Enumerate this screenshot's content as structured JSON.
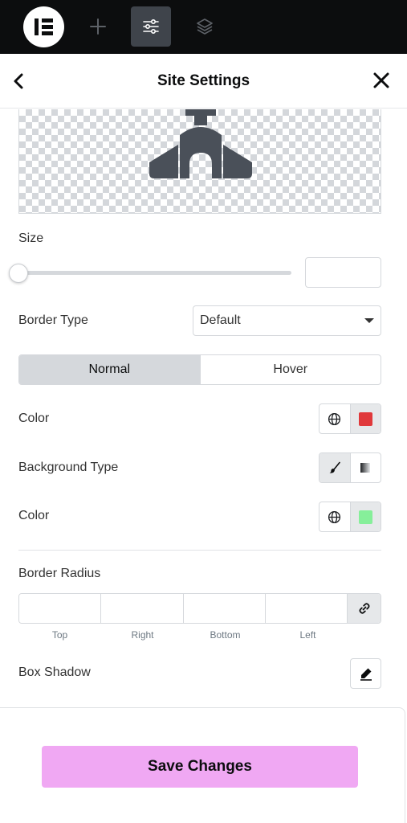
{
  "topbar": {
    "logo_icon": "elementor-logo-icon",
    "buttons": [
      {
        "name": "add-icon"
      },
      {
        "name": "site-settings-icon",
        "active": true
      },
      {
        "name": "layers-icon"
      }
    ]
  },
  "header": {
    "title": "Site Settings",
    "back_icon": "chevron-left-icon",
    "close_icon": "close-icon"
  },
  "preview": {
    "icon": "building-icon",
    "icon_color": "#4a5059"
  },
  "size": {
    "label": "Size",
    "value": "",
    "slider_fraction": 0
  },
  "border_type": {
    "label": "Border Type",
    "selected": "Default"
  },
  "tabs": {
    "normal": "Normal",
    "hover": "Hover",
    "active": "Normal"
  },
  "color1": {
    "label": "Color",
    "swatch": "#e0393b"
  },
  "background_type": {
    "label": "Background Type",
    "options": [
      "classic-brush-icon",
      "gradient-icon"
    ],
    "active": "classic-brush-icon"
  },
  "color2": {
    "label": "Color",
    "swatch": "#86ef9a"
  },
  "border_radius": {
    "label": "Border Radius",
    "sides": [
      "Top",
      "Right",
      "Bottom",
      "Left"
    ]
  },
  "box_shadow": {
    "label": "Box Shadow"
  },
  "footer": {
    "save_label": "Save Changes",
    "save_color": "#f0a8f3"
  }
}
